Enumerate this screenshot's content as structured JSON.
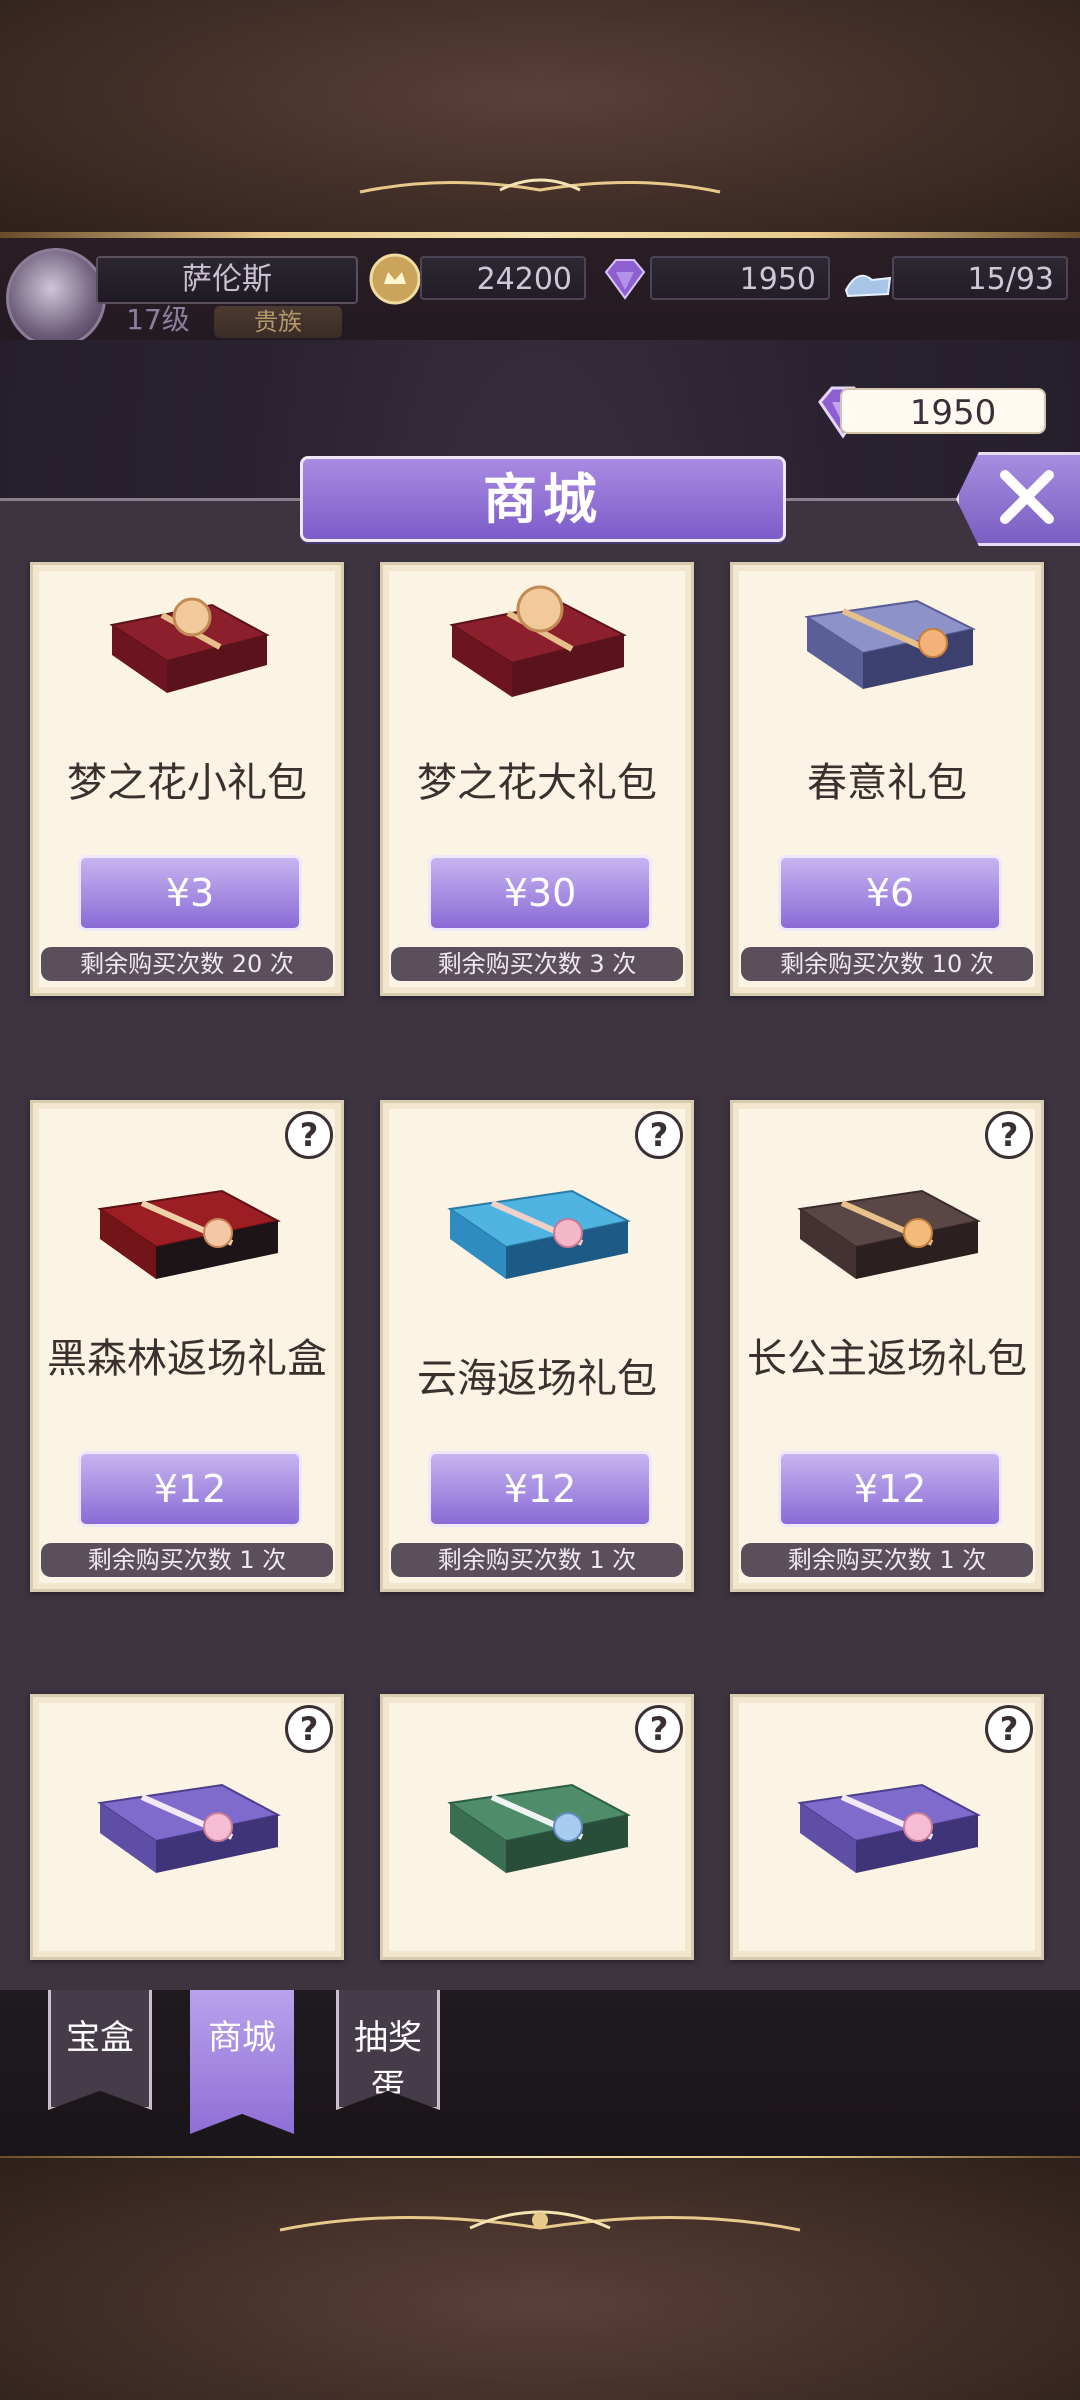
{
  "header": {
    "player_name": "萨伦斯",
    "level": "17级",
    "rank": "贵族",
    "gold": "24200",
    "gems": "1950",
    "stamina": "15/93"
  },
  "shop": {
    "gem_balance": "1950",
    "title": "商城",
    "close_label": "X"
  },
  "cards": [
    {
      "name": "梦之花小礼包",
      "price": "¥3",
      "remain": "剩余购买次数 20 次"
    },
    {
      "name": "梦之花大礼包",
      "price": "¥30",
      "remain": "剩余购买次数 3 次"
    },
    {
      "name": "春意礼包",
      "price": "¥6",
      "remain": "剩余购买次数 10 次"
    },
    {
      "name": "黑森林返场礼盒",
      "price": "¥12",
      "remain": "剩余购买次数 1 次",
      "help": "?"
    },
    {
      "name": "云海返场礼包",
      "price": "¥12",
      "remain": "剩余购买次数 1 次",
      "help": "?"
    },
    {
      "name": "长公主返场礼包",
      "price": "¥12",
      "remain": "剩余购买次数 1 次",
      "help": "?"
    },
    {
      "help": "?"
    },
    {
      "help": "?"
    },
    {
      "help": "?"
    }
  ],
  "tabs": [
    "宝盒",
    "商城",
    "抽奖蛋"
  ],
  "colors": {
    "accent": "#8a6bd6",
    "card_bg": "#fbf3e4",
    "panel_bg": "#3d3440"
  }
}
